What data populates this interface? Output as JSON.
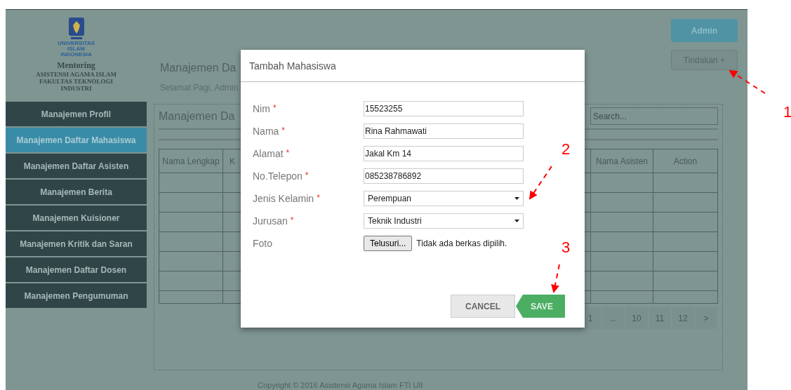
{
  "sidebar": {
    "logo_caption": [
      "UNIVERSITAS",
      "ISLAM",
      "INDONESIA"
    ],
    "app_title": "Mentoring",
    "subtitle_lines": [
      "ASISTENSI AGAMA ISLAM",
      "FAKULTAS TEKNOLOGI",
      "INDUSTRI"
    ],
    "items": [
      {
        "label": "Manajemen Profil",
        "selected": false
      },
      {
        "label": "Manajemen Daftar Mahasiswa",
        "selected": true
      },
      {
        "label": "Manajemen Daftar Asisten",
        "selected": false
      },
      {
        "label": "Manajemen Berita",
        "selected": false
      },
      {
        "label": "Manajemen Kuisioner",
        "selected": false
      },
      {
        "label": "Manajemen Kritik dan Saran",
        "selected": false
      },
      {
        "label": "Manajemen Daftar Dosen",
        "selected": false
      },
      {
        "label": "Manajemen Pengumuman",
        "selected": false
      }
    ]
  },
  "header": {
    "title": "Manajemen Da",
    "greeting": "Selamat Pagi, Admin",
    "user_button": "Admin",
    "action_button": "Tindakan +"
  },
  "panel": {
    "title": "Manajemen Da",
    "search": {
      "placeholder": "Search..."
    },
    "table": {
      "columns": [
        "Nama Lengkap",
        "K",
        "Nama Asisten",
        "Action"
      ]
    },
    "pagination": [
      "1",
      "...",
      "10",
      "11",
      "12",
      ">"
    ]
  },
  "modal": {
    "title": "Tambah Mahasiswa",
    "fields": [
      {
        "kind": "text",
        "label": "Nim",
        "required_mark": "*",
        "value": "15523255"
      },
      {
        "kind": "text",
        "label": "Nama",
        "required_mark": "*",
        "value": "Rina Rahmawati"
      },
      {
        "kind": "text",
        "label": "Alamat",
        "required_mark": "*",
        "value": "Jakal Km 14"
      },
      {
        "kind": "text",
        "label": "No.Telepon",
        "required_mark": "*",
        "value": "085238786892"
      },
      {
        "kind": "select",
        "label": "Jenis Kelamin",
        "required_mark": "*",
        "value": "Perempuan"
      },
      {
        "kind": "select",
        "label": "Jurusan",
        "required_mark": "*",
        "value": "Teknik Industri"
      },
      {
        "kind": "file",
        "label": "Foto",
        "button": "Telusuri...",
        "status": "Tidak ada berkas dipilih."
      }
    ],
    "buttons": [
      {
        "kind": "cancel",
        "label": "CANCEL"
      },
      {
        "kind": "save",
        "label": "SAVE"
      }
    ]
  },
  "footer": {
    "copyright": "Copyright © 2016 Asistensi Agama Islam FTI UII"
  },
  "annotations": [
    {
      "label": "1"
    },
    {
      "label": "2"
    },
    {
      "label": "3"
    }
  ]
}
